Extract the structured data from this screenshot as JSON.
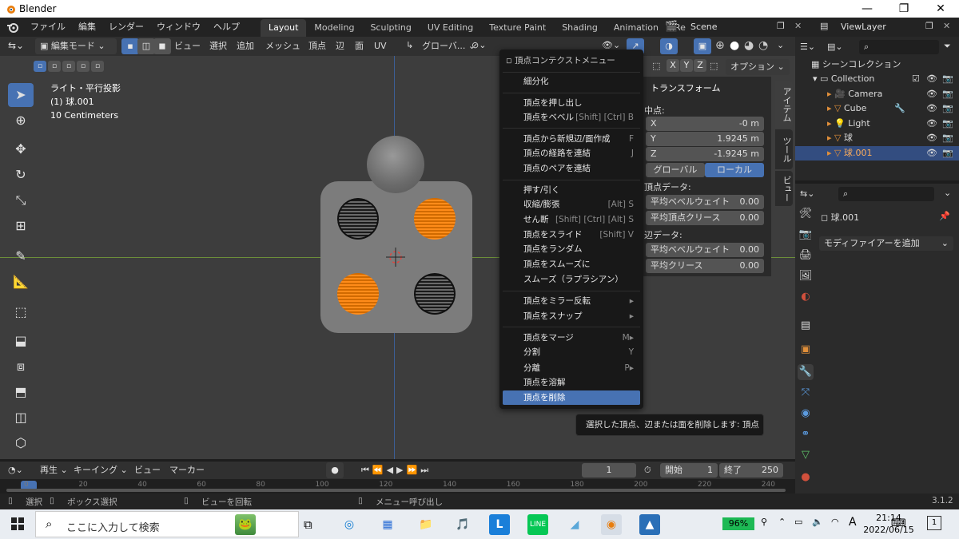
{
  "window": {
    "title": "Blender",
    "min": "—",
    "max": "❐",
    "close": "✕"
  },
  "topbar": {
    "menus": [
      "ファイル",
      "編集",
      "レンダー",
      "ウィンドウ",
      "ヘルプ"
    ],
    "workspaces": [
      "Layout",
      "Modeling",
      "Sculpting",
      "UV Editing",
      "Texture Paint",
      "Shading",
      "Animation",
      "Rendering"
    ],
    "active_workspace": "Layout",
    "scene": "Scene",
    "view_layer": "ViewLayer"
  },
  "vphead": {
    "mode": "編集モード",
    "menus": [
      "ビュー",
      "選択",
      "追加",
      "メッシュ",
      "頂点",
      "辺",
      "面",
      "UV"
    ],
    "orientation": "グローバ...",
    "options": "オプション"
  },
  "overlay_info": {
    "line1": "ライト・平行投影",
    "line2": "(1) 球.001",
    "line3": "10 Centimeters"
  },
  "context_menu": {
    "title": "頂点コンテクストメニュー",
    "items": [
      {
        "label": "細分化",
        "sc": ""
      },
      {
        "label": "頂点を押し出し",
        "sc": ""
      },
      {
        "label": "頂点をベベル",
        "sc": "[Shift] [Ctrl] B"
      },
      {
        "label": "頂点から新規辺/面作成",
        "sc": "F"
      },
      {
        "label": "頂点の経路を連結",
        "sc": "J"
      },
      {
        "label": "頂点のペアを連結",
        "sc": ""
      },
      {
        "label": "押す/引く",
        "sc": ""
      },
      {
        "label": "収縮/膨張",
        "sc": "[Alt] S"
      },
      {
        "label": "せん断",
        "sc": "[Shift] [Ctrl] [Alt] S"
      },
      {
        "label": "頂点をスライド",
        "sc": "[Shift] V"
      },
      {
        "label": "頂点をランダム",
        "sc": ""
      },
      {
        "label": "頂点をスムーズに",
        "sc": ""
      },
      {
        "label": "スムーズ（ラプラシアン）",
        "sc": ""
      },
      {
        "label": "頂点をミラー反転",
        "sc": "▸"
      },
      {
        "label": "頂点をスナップ",
        "sc": "▸"
      },
      {
        "label": "頂点をマージ",
        "sc": "M▸"
      },
      {
        "label": "分割",
        "sc": "Y"
      },
      {
        "label": "分離",
        "sc": "P▸"
      },
      {
        "label": "頂点を溶解",
        "sc": ""
      },
      {
        "label": "頂点を削除",
        "sc": ""
      }
    ]
  },
  "tooltip": "選択した頂点、辺または面を削除します: 頂点",
  "npanel": {
    "title": "トランスフォーム",
    "median": "中点:",
    "x_label": "X",
    "x_val": "-0 m",
    "y_label": "Y",
    "y_val": "1.9245 m",
    "z_label": "Z",
    "z_val": "-1.9245 m",
    "global": "グローバル",
    "local": "ローカル",
    "vertex_data": "頂点データ:",
    "bevel_w": "平均ベベルウェイト",
    "bevel_w_val": "0.00",
    "crease_v": "平均頂点クリース",
    "crease_v_val": "0.00",
    "edge_data": "辺データ:",
    "bevel_w2": "平均ベベルウェイト",
    "bevel_w2_val": "0.00",
    "crease": "平均クリース",
    "crease_val": "0.00",
    "tabs": [
      "アイテム",
      "ツール",
      "ビュー"
    ],
    "axes": [
      "X",
      "Y",
      "Z"
    ]
  },
  "outliner": {
    "root": "シーンコレクション",
    "collection": "Collection",
    "items": [
      "Camera",
      "Cube",
      "Light",
      "球",
      "球.001"
    ]
  },
  "props": {
    "object": "球.001",
    "add_modifier": "モディファイアーを追加"
  },
  "timeline": {
    "menus": [
      "再生",
      "キーイング",
      "ビュー",
      "マーカー"
    ],
    "frame": "1",
    "start_label": "開始",
    "start": "1",
    "end_label": "終了",
    "end": "250",
    "ticks": [
      "0",
      "20",
      "40",
      "60",
      "80",
      "100",
      "120",
      "140",
      "160",
      "180",
      "200",
      "220",
      "240"
    ]
  },
  "status": {
    "select": "選択",
    "box": "ボックス選択",
    "rotate": "ビューを回転",
    "menu": "メニュー呼び出し",
    "version": "3.1.2"
  },
  "taskbar": {
    "search": "ここに入力して検索",
    "battery": "96%",
    "time": "21:14",
    "date": "2022/06/15",
    "ime": "A",
    "notif": "1"
  }
}
